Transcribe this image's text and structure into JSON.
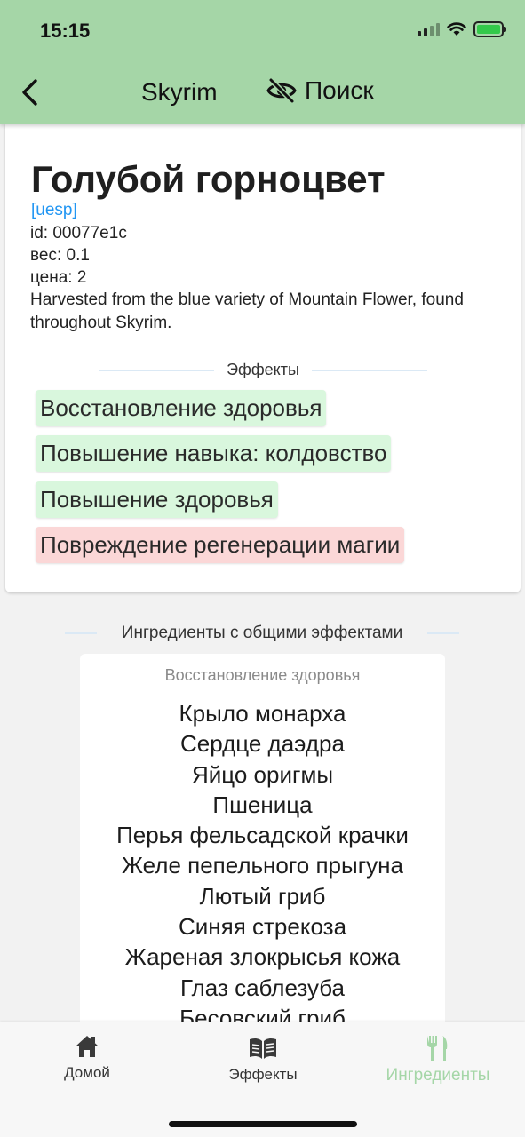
{
  "status_bar": {
    "time": "15:15"
  },
  "header": {
    "title": "Skyrim",
    "search_label": "Поиск"
  },
  "ingredient": {
    "name": "Голубой горноцвет",
    "link_label": "[uesp]",
    "id_line": "id: 00077e1c",
    "weight_line": "вес: 0.1",
    "price_line": "цена: 2",
    "description": "Harvested from the blue variety of Mountain Flower, found throughout Skyrim.",
    "effects_heading": "Эффекты",
    "effects": [
      {
        "label": "Восстановление здоровья",
        "kind": "positive"
      },
      {
        "label": "Повышение навыка: колдовство",
        "kind": "positive"
      },
      {
        "label": "Повышение здоровья",
        "kind": "positive"
      },
      {
        "label": "Повреждение регенерации магии",
        "kind": "negative"
      }
    ]
  },
  "shared": {
    "heading": "Ингредиенты с общими эффектами",
    "effect_title": "Восстановление здоровья",
    "items": [
      "Крыло монарха",
      "Сердце даэдра",
      "Яйцо оригмы",
      "Пшеница",
      "Перья фельсадской крачки",
      "Желе пепельного прыгуна",
      "Лютый гриб",
      "Синяя стрекоза",
      "Жареная злокрысья кожа",
      "Глаз саблезуба",
      "Бесовский гриб"
    ]
  },
  "bottom_nav": {
    "items": [
      {
        "label": "Домой",
        "icon": "home-icon"
      },
      {
        "label": "Эффекты",
        "icon": "book-icon"
      },
      {
        "label": "Ингредиенты",
        "icon": "fork-knife-icon",
        "active": true
      }
    ]
  },
  "colors": {
    "header_bg": "#a5d6a7",
    "positive_chip": "#d9f7dd",
    "negative_chip": "#fbd7d7",
    "link": "#2196f3",
    "active_nav": "#a5d6a7"
  }
}
